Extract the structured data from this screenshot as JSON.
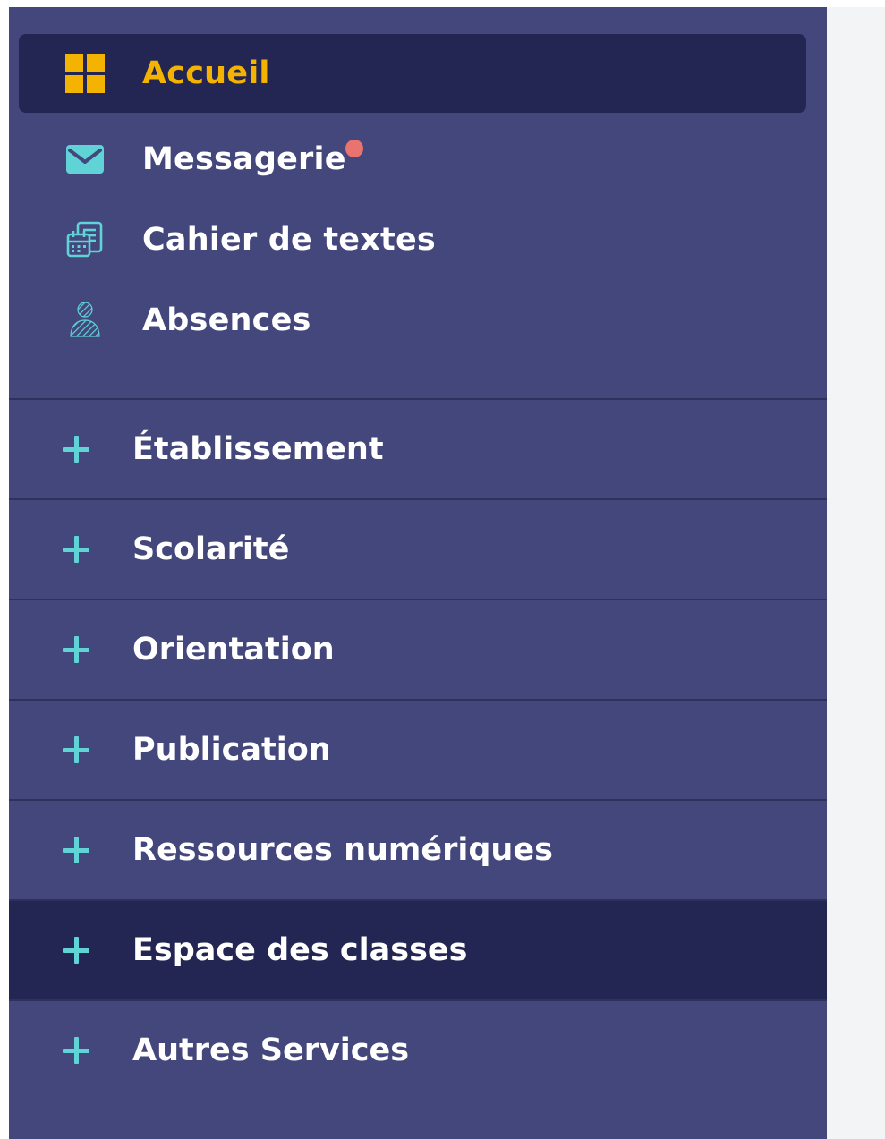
{
  "sidebar": {
    "top_items": [
      {
        "label": "Accueil",
        "icon": "grid-icon",
        "active": true
      },
      {
        "label": "Messagerie",
        "icon": "envelope-icon",
        "has_notification": true
      },
      {
        "label": "Cahier de textes",
        "icon": "calendar-notebook-icon"
      },
      {
        "label": "Absences",
        "icon": "person-hatched-icon"
      }
    ],
    "sections": [
      {
        "label": "Établissement",
        "icon": "plus-icon"
      },
      {
        "label": "Scolarité",
        "icon": "plus-icon"
      },
      {
        "label": "Orientation",
        "icon": "plus-icon"
      },
      {
        "label": "Publication",
        "icon": "plus-icon"
      },
      {
        "label": "Ressources numériques",
        "icon": "plus-icon"
      },
      {
        "label": "Espace des classes",
        "icon": "plus-icon",
        "highlighted": true
      },
      {
        "label": "Autres Services",
        "icon": "plus-icon"
      }
    ]
  },
  "colors": {
    "sidebar_bg": "#44477b",
    "active_bg": "#232653",
    "active_text": "#f5b301",
    "accent_cyan": "#5fd3d6",
    "notification": "#e8736f",
    "content_bg": "#f3f4f6"
  }
}
